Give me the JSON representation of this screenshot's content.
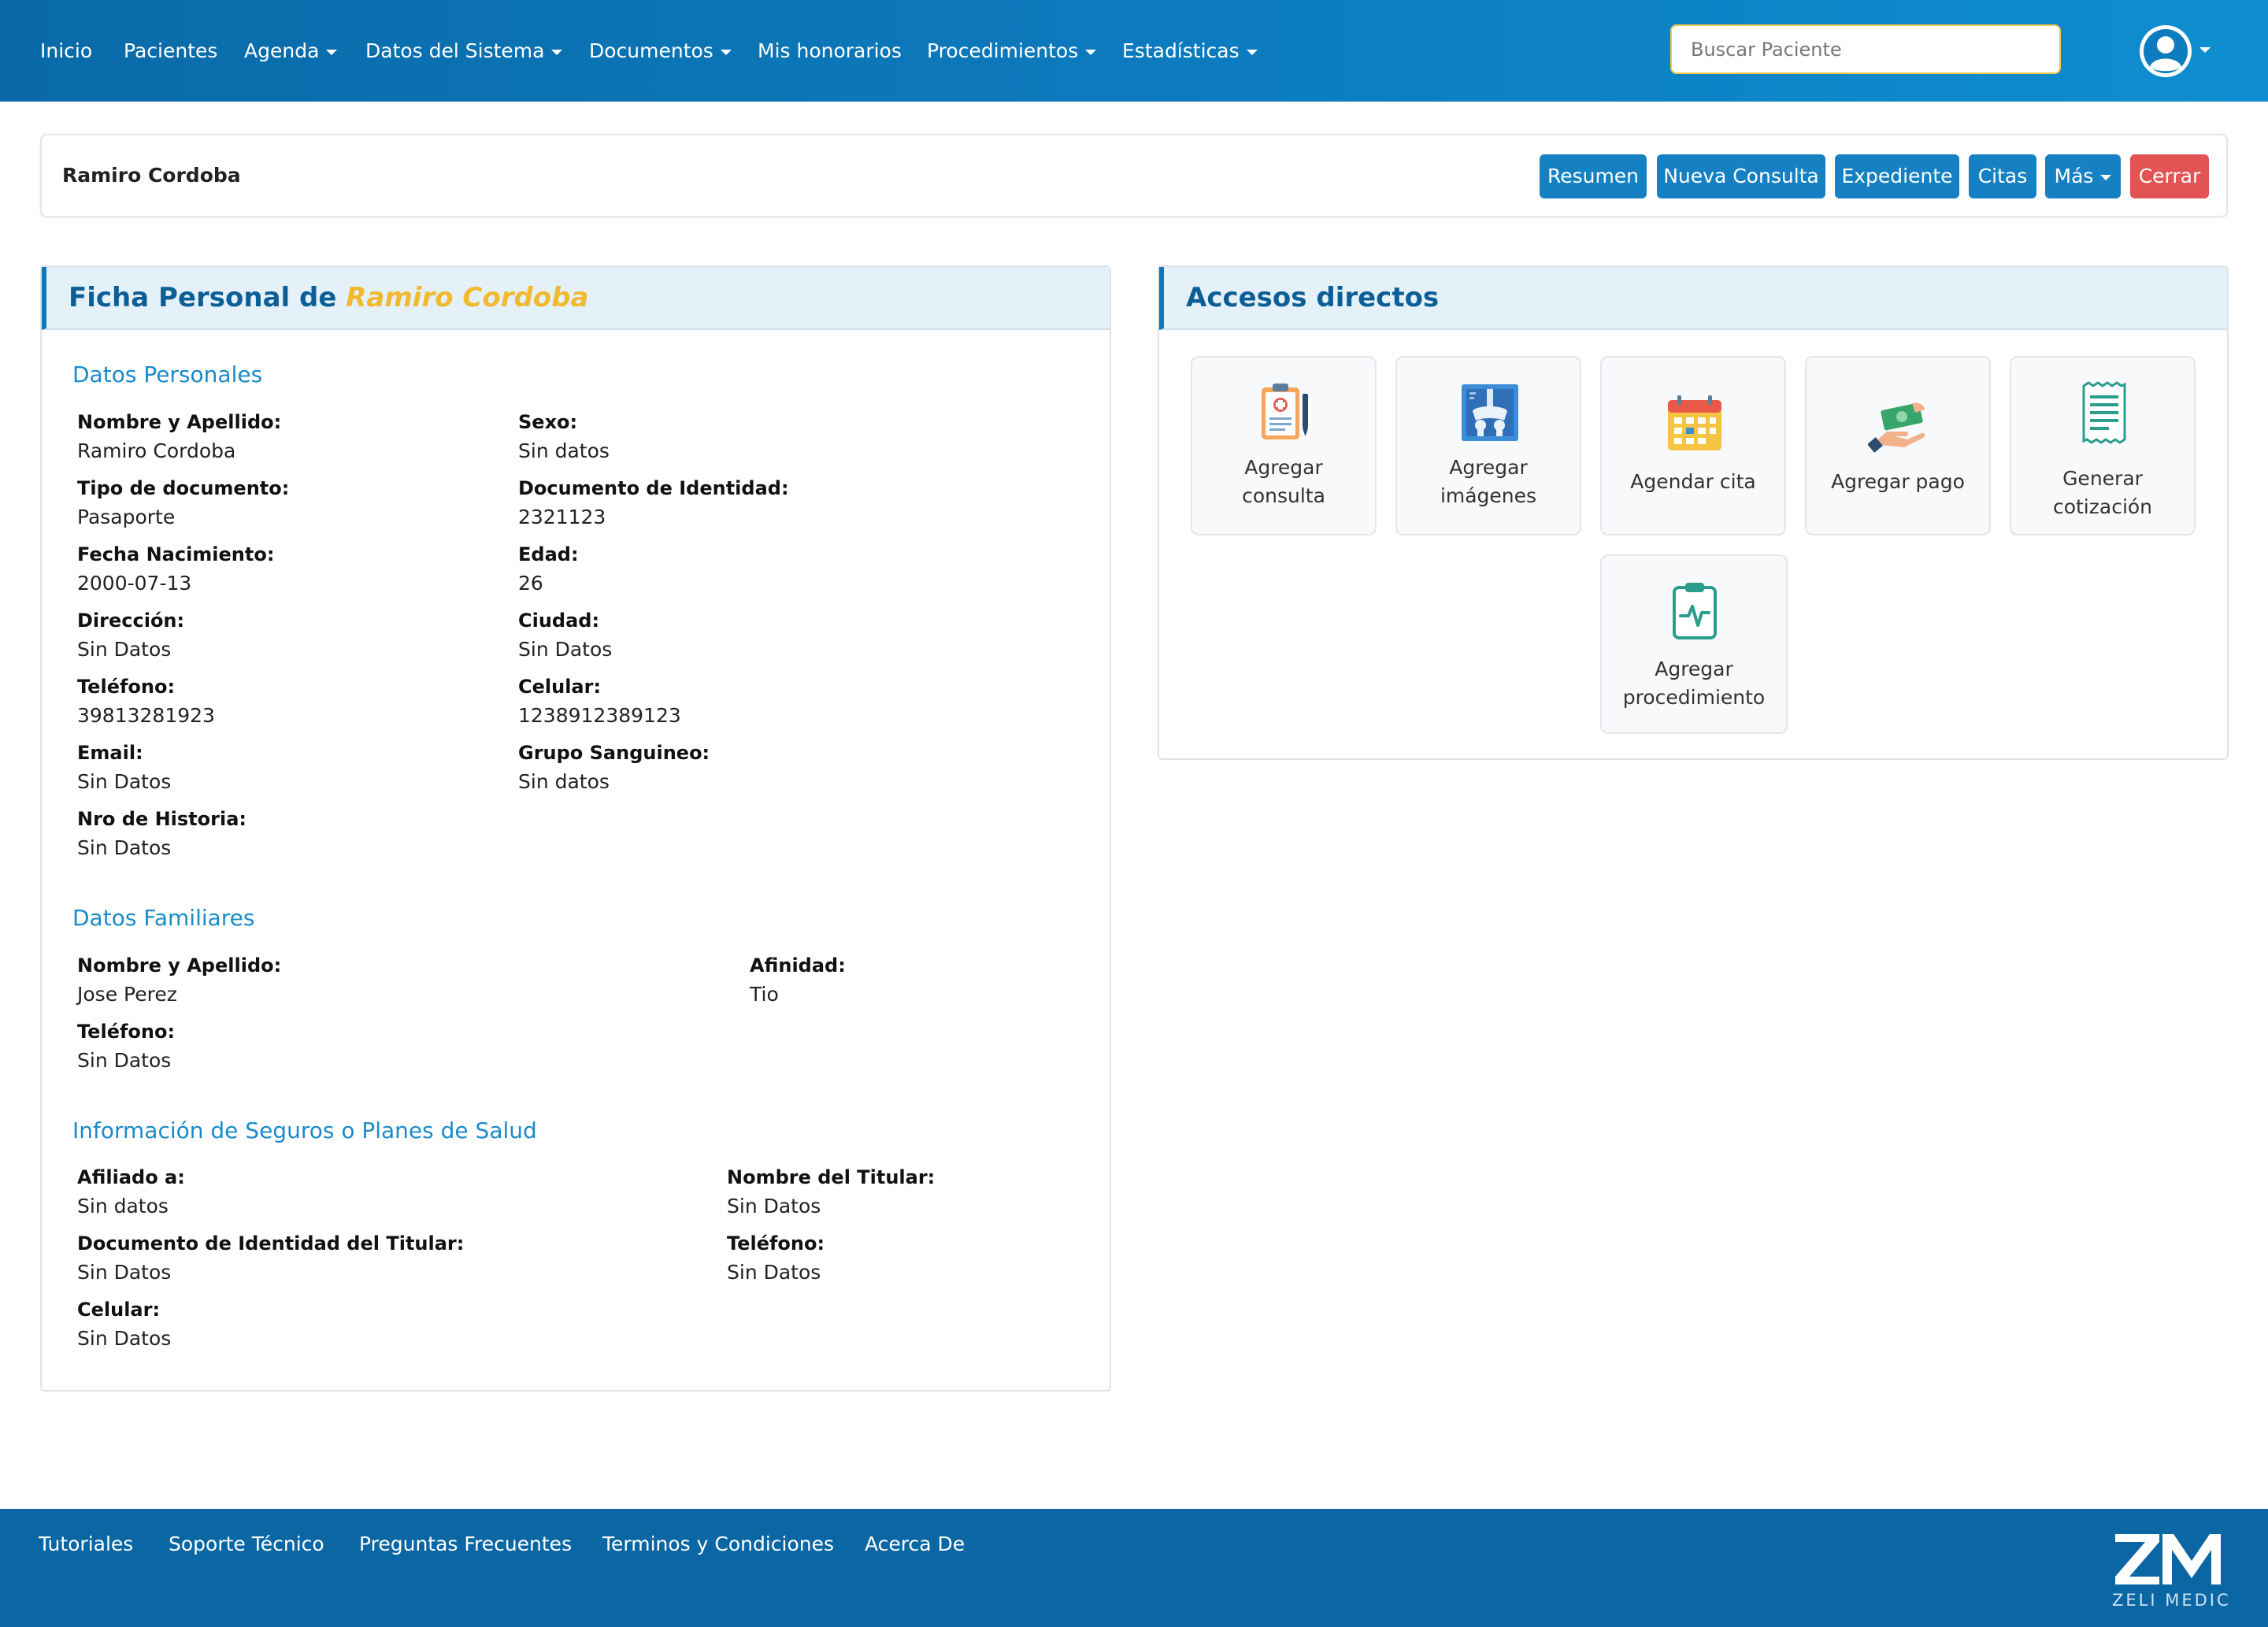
{
  "nav": {
    "items": [
      {
        "label": "Inicio",
        "dropdown": false
      },
      {
        "label": "Pacientes",
        "dropdown": false
      },
      {
        "label": "Agenda",
        "dropdown": true
      },
      {
        "label": "Datos del Sistema",
        "dropdown": true
      },
      {
        "label": "Documentos",
        "dropdown": true
      },
      {
        "label": "Mis honorarios",
        "dropdown": false
      },
      {
        "label": "Procedimientos",
        "dropdown": true
      },
      {
        "label": "Estadísticas",
        "dropdown": true
      }
    ],
    "search_placeholder": "Buscar Paciente",
    "user_icon": "user-circle-icon"
  },
  "patient_bar": {
    "name": "Ramiro Cordoba",
    "buttons": [
      "Resumen",
      "Nueva Consulta",
      "Expediente",
      "Citas",
      "Más",
      "Cerrar"
    ]
  },
  "ficha": {
    "title_prefix": "Ficha Personal de",
    "title_name": "Ramiro Cordoba",
    "personal": {
      "title": "Datos Personales",
      "fields": [
        {
          "label": "Nombre y Apellido:",
          "value": "Ramiro Cordoba"
        },
        {
          "label": "Sexo:",
          "value": "Sin datos"
        },
        {
          "label": "Tipo de documento:",
          "value": "Pasaporte"
        },
        {
          "label": "Documento de Identidad:",
          "value": "2321123"
        },
        {
          "label": "Fecha Nacimiento:",
          "value": "2000-07-13"
        },
        {
          "label": "Edad:",
          "value": "26"
        },
        {
          "label": "Dirección:",
          "value": "Sin Datos"
        },
        {
          "label": "Ciudad:",
          "value": "Sin Datos"
        },
        {
          "label": "Teléfono:",
          "value": "39813281923"
        },
        {
          "label": "Celular:",
          "value": "1238912389123"
        },
        {
          "label": "Email:",
          "value": "Sin Datos"
        },
        {
          "label": "Grupo Sanguineo:",
          "value": "Sin datos"
        },
        {
          "label": "Nro de Historia:",
          "value": "Sin Datos"
        }
      ]
    },
    "familiares": {
      "title": "Datos Familiares",
      "fields": [
        {
          "label": "Nombre y Apellido:",
          "value": "Jose Perez"
        },
        {
          "label": "Afinidad:",
          "value": "Tio"
        },
        {
          "label": "Teléfono:",
          "value": "Sin Datos"
        }
      ]
    },
    "seguros": {
      "title": "Información de Seguros o Planes de Salud",
      "fields": [
        {
          "label": "Afiliado a:",
          "value": "Sin datos"
        },
        {
          "label": "Nombre del Titular:",
          "value": "Sin Datos"
        },
        {
          "label": "Documento de Identidad del Titular:",
          "value": "Sin Datos"
        },
        {
          "label": "Teléfono:",
          "value": "Sin Datos"
        },
        {
          "label": "Celular:",
          "value": "Sin Datos"
        }
      ]
    }
  },
  "accesos": {
    "title": "Accesos directos",
    "tiles": [
      {
        "line1": "Agregar",
        "line2": "consulta",
        "icon": "clipboard-medical-icon"
      },
      {
        "line1": "Agregar",
        "line2": "imágenes",
        "icon": "xray-icon"
      },
      {
        "line1": "Agendar cita",
        "line2": "",
        "icon": "calendar-icon"
      },
      {
        "line1": "Agregar pago",
        "line2": "",
        "icon": "payment-icon"
      },
      {
        "line1": "Generar",
        "line2": "cotización",
        "icon": "receipt-icon"
      },
      {
        "line1": "Agregar",
        "line2": "procedimiento",
        "icon": "clipboard-pulse-icon"
      }
    ]
  },
  "footer": {
    "links": [
      "Tutoriales",
      "Soporte Técnico",
      "Preguntas Frecuentes",
      "Terminos y Condiciones",
      "Acerca De"
    ],
    "logo_text": "ZELI MEDIC"
  },
  "colors": {
    "nav_bg": "#0c7cbf",
    "button_blue": "#1581c3",
    "button_red": "#e25353",
    "accent_yellow": "#f0b92e",
    "section_blue": "#1a8bc9",
    "footer_bg": "#0a67a4"
  }
}
